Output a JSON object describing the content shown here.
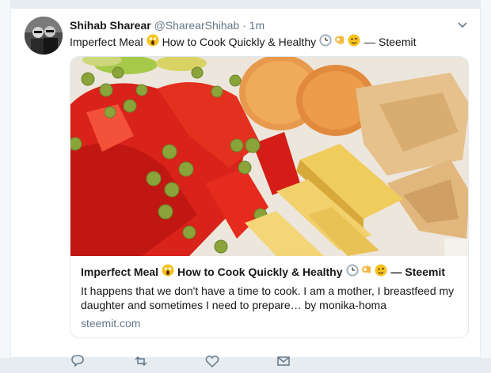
{
  "tweet": {
    "author_name": "Shihab Sharear",
    "handle": "@SharearShihab",
    "separator": "·",
    "time": "1m",
    "text_before": "Imperfect Meal",
    "text_mid": "How to Cook Quickly & Healthy",
    "text_after": "— Steemit"
  },
  "card": {
    "title_before": "Imperfect Meal",
    "title_mid": "How to Cook Quickly & Healthy",
    "title_after": "— Steemit",
    "description": "It happens that we don't have a time to cook. I am a mother, I breastfeed my daughter and sometimes I need to prepare… by monika-homa",
    "domain": "steemit.com"
  },
  "icons": [
    "screaming-face-icon",
    "clock-icon",
    "ok-hand-icon",
    "winking-face-icon",
    "chevron-down-icon",
    "reply-icon",
    "retweet-icon",
    "like-icon",
    "message-icon"
  ]
}
